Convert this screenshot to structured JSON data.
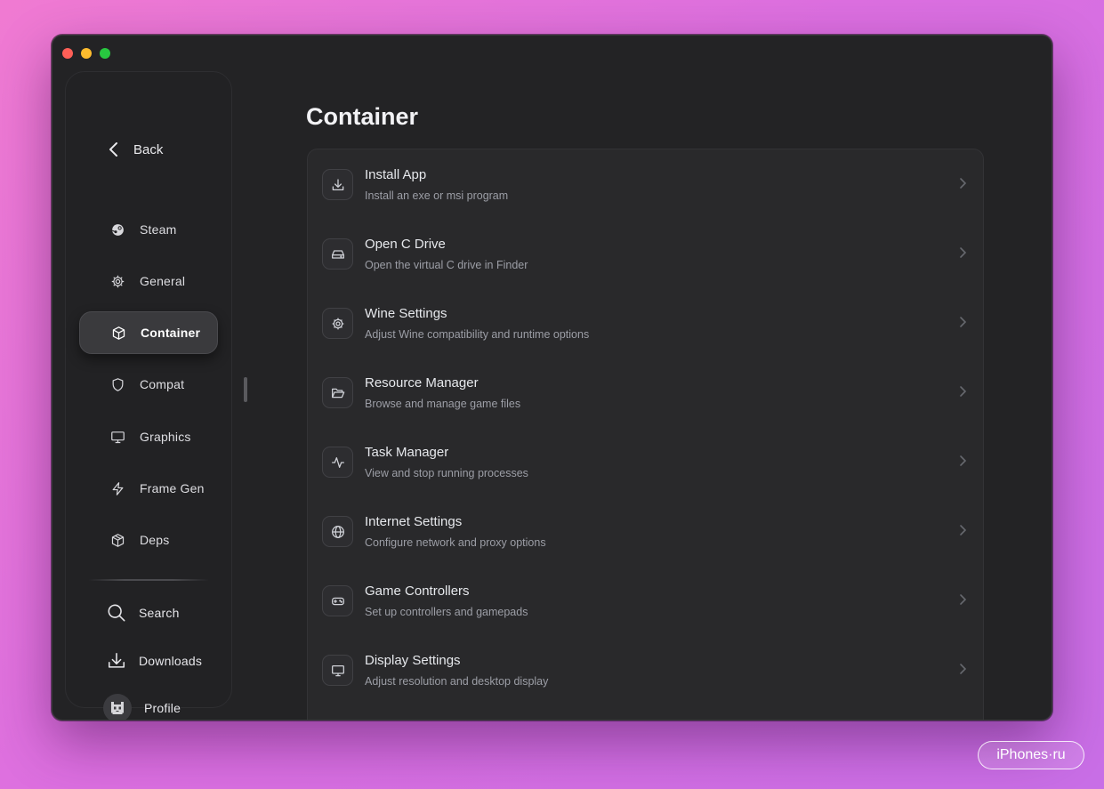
{
  "sidebar": {
    "back_label": "Back",
    "items": [
      {
        "label": "Steam",
        "icon": "steam-icon"
      },
      {
        "label": "General",
        "icon": "gear-icon"
      },
      {
        "label": "Container",
        "icon": "box-icon",
        "active": true
      },
      {
        "label": "Compat",
        "icon": "shield-icon"
      },
      {
        "label": "Graphics",
        "icon": "monitor-icon"
      },
      {
        "label": "Frame Gen",
        "icon": "bolt-icon"
      },
      {
        "label": "Deps",
        "icon": "package-icon"
      }
    ],
    "bottom": [
      {
        "label": "Search",
        "icon": "search-icon"
      },
      {
        "label": "Downloads",
        "icon": "download-icon"
      },
      {
        "label": "Profile",
        "icon": "avatar"
      }
    ]
  },
  "main": {
    "title": "Container",
    "rows": [
      {
        "title": "Install App",
        "subtitle": "Install an exe or msi program",
        "icon": "download-icon"
      },
      {
        "title": "Open C Drive",
        "subtitle": "Open the virtual C drive in Finder",
        "icon": "drive-icon"
      },
      {
        "title": "Wine Settings",
        "subtitle": "Adjust Wine compatibility and runtime options",
        "icon": "gear-icon"
      },
      {
        "title": "Resource Manager",
        "subtitle": "Browse and manage game files",
        "icon": "folder-icon"
      },
      {
        "title": "Task Manager",
        "subtitle": "View and stop running processes",
        "icon": "activity-icon"
      },
      {
        "title": "Internet Settings",
        "subtitle": "Configure network and proxy options",
        "icon": "globe-icon"
      },
      {
        "title": "Game Controllers",
        "subtitle": "Set up controllers and gamepads",
        "icon": "gamepad-icon"
      },
      {
        "title": "Display Settings",
        "subtitle": "Adjust resolution and desktop display",
        "icon": "monitor-icon"
      }
    ]
  },
  "watermark": "iPhones·ru",
  "colors": {
    "window_bg": "#232325",
    "panel_bg": "#29292b",
    "active_item_bg": "#3a3a3d",
    "traffic_red": "#fe5f57",
    "traffic_yellow": "#febc2e",
    "traffic_green": "#28c840"
  }
}
